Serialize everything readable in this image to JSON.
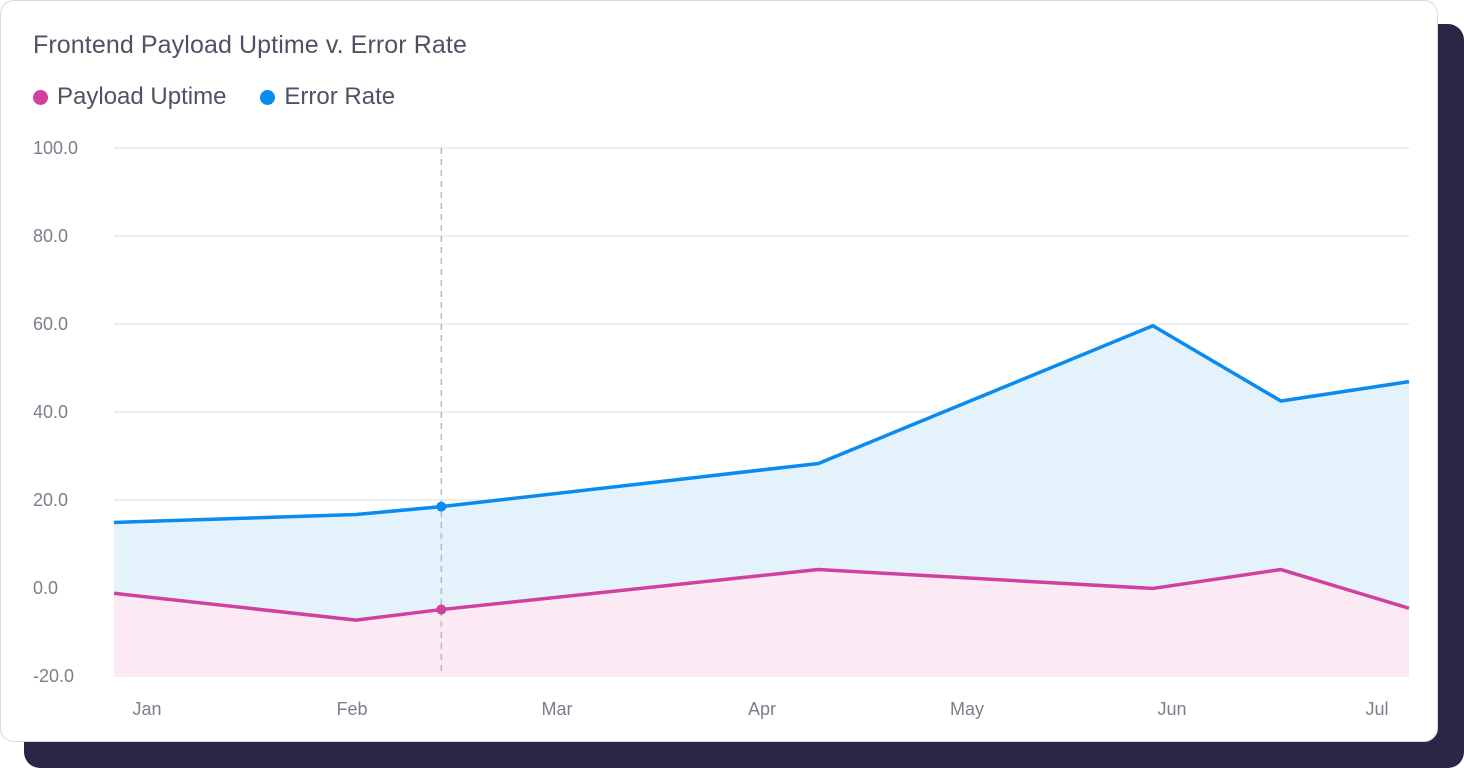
{
  "colors": {
    "uptime": "#d0409f",
    "uptime_fill": "#fbe9f4",
    "error": "#0a8bf0",
    "error_fill": "#e4f2fc",
    "grid": "#e3e4e8",
    "crosshair": "#b9bbc4"
  },
  "chart_data": {
    "type": "area",
    "title": "Frontend Payload Uptime v. Error Rate",
    "xlabel": "",
    "ylabel": "",
    "categories": [
      "Jan",
      "Feb",
      "Mar",
      "Apr",
      "May",
      "Jun",
      "Jul"
    ],
    "y_ticks": [
      "100.0",
      "80.0",
      "60.0",
      "40.0",
      "20.0",
      "0.0",
      "-20.0"
    ],
    "ylim": [
      -20,
      100
    ],
    "legend_position": "top-left",
    "grid": true,
    "series": [
      {
        "name": "Payload Uptime",
        "x": [
          "2024-01-01",
          "2024-02-04",
          "2024-02-16",
          "2024-04-09",
          "2024-05-26",
          "2024-06-13",
          "2024-07-01"
        ],
        "values": [
          -1.2,
          -7.3,
          -4.9,
          4.2,
          -0.1,
          4.2,
          -4.6
        ]
      },
      {
        "name": "Error Rate",
        "x": [
          "2024-01-01",
          "2024-02-04",
          "2024-02-16",
          "2024-04-09",
          "2024-05-26",
          "2024-06-13",
          "2024-07-01"
        ],
        "values": [
          14.9,
          16.7,
          18.5,
          28.3,
          59.6,
          42.5,
          46.9
        ]
      }
    ],
    "hover_x": "2024-02-16"
  }
}
